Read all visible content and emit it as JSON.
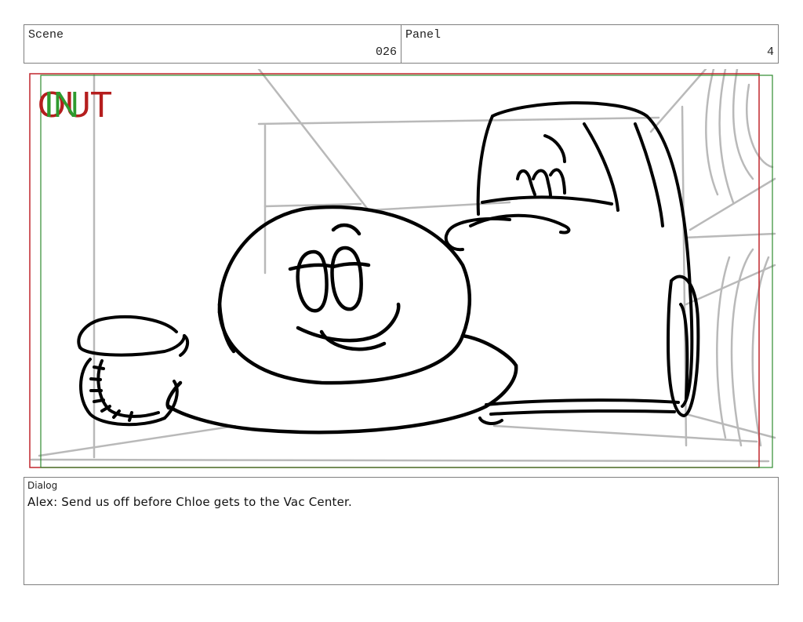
{
  "header": {
    "scene_label": "Scene",
    "scene_value": "026",
    "panel_label": "Panel",
    "panel_value": "4"
  },
  "frame": {
    "in_marker": "IN",
    "out_marker": "OUT",
    "in_color": "#2e9a2e",
    "out_color": "#b51e1e"
  },
  "dialog": {
    "label": "Dialog",
    "text": "Alex: Send us off before Chloe gets to the Vac Center."
  }
}
